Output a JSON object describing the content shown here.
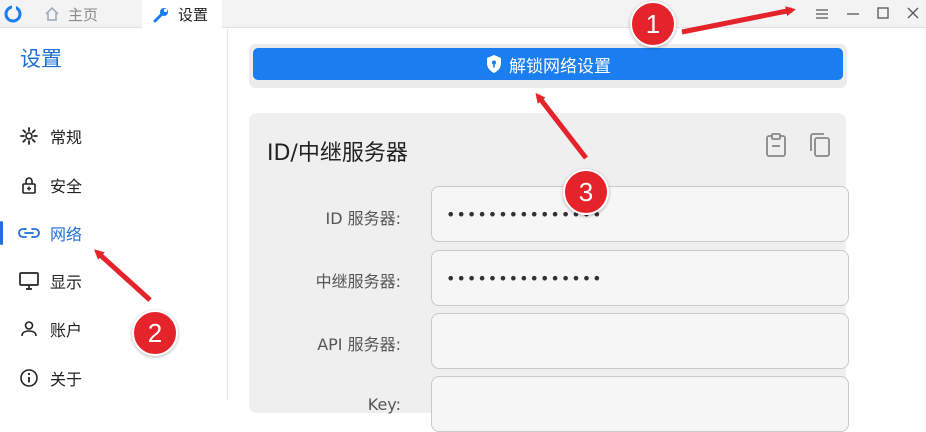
{
  "tabs": {
    "home_label": "主页",
    "settings_label": "设置"
  },
  "sidebar": {
    "title": "设置",
    "items": [
      {
        "label": "常规",
        "icon": "gear-icon"
      },
      {
        "label": "安全",
        "icon": "lock-icon"
      },
      {
        "label": "网络",
        "icon": "link-icon",
        "active": true
      },
      {
        "label": "显示",
        "icon": "monitor-icon"
      },
      {
        "label": "账户",
        "icon": "person-icon"
      },
      {
        "label": "关于",
        "icon": "info-icon"
      }
    ]
  },
  "main": {
    "unlock_button_label": "解锁网络设置",
    "card_title": "ID/中继服务器",
    "fields": [
      {
        "label": "ID 服务器:",
        "value": "•••••••••••••••"
      },
      {
        "label": "中继服务器:",
        "value": "•••••••••••••••"
      },
      {
        "label": "API 服务器:",
        "value": ""
      },
      {
        "label": "Key:",
        "value": ""
      }
    ]
  },
  "annotations": {
    "badge1": "1",
    "badge2": "2",
    "badge3": "3"
  },
  "colors": {
    "accent": "#1f6fd6",
    "button": "#1a7df0",
    "annotation": "#e5232b"
  }
}
